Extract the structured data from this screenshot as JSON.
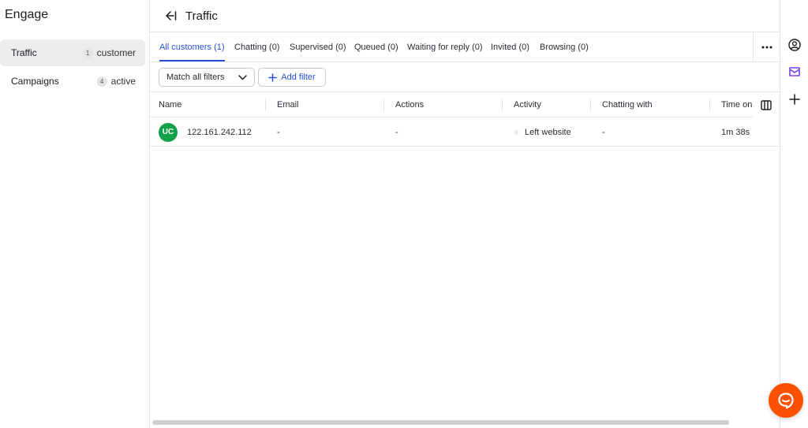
{
  "sidebar": {
    "title": "Engage",
    "items": [
      {
        "label": "Traffic",
        "count": "1",
        "meta": "customer"
      },
      {
        "label": "Campaigns",
        "count": "4",
        "meta": "active"
      }
    ]
  },
  "header": {
    "title": "Traffic"
  },
  "tabs": [
    {
      "label": "All customers (1)"
    },
    {
      "label": "Chatting (0)"
    },
    {
      "label": "Supervised (0)"
    },
    {
      "label": "Queued (0)"
    },
    {
      "label": "Waiting for reply (0)"
    },
    {
      "label": "Invited (0)"
    },
    {
      "label": "Browsing (0)"
    }
  ],
  "filters": {
    "match_select": "Match all filters",
    "add_filter": "Add filter"
  },
  "table": {
    "columns": [
      "Name",
      "Email",
      "Actions",
      "Activity",
      "Chatting with",
      "Time on"
    ],
    "rows": [
      {
        "initials": "UC",
        "name": "122.161.242.112",
        "email": "-",
        "actions": "-",
        "activity": "Left website",
        "chatting_with": "-",
        "time_on": "1m 38s"
      }
    ]
  },
  "colors": {
    "accent": "#2950d9",
    "avatar": "#13a04a",
    "launcher": "#fe5100",
    "rail_icon_purple": "#7b3fe4"
  },
  "icons": [
    "back-arrow-icon",
    "more-horizontal-icon",
    "chevron-down-icon",
    "plus-icon",
    "columns-icon",
    "user-circle-icon",
    "inbox-icon",
    "chat-bubble-icon"
  ]
}
